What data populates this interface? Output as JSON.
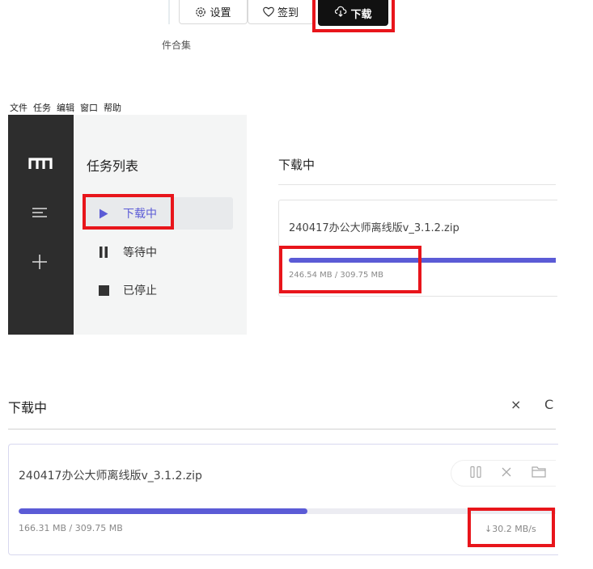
{
  "toolbar": {
    "settings_label": "设置",
    "checkin_label": "签到",
    "download_label": "下载",
    "collection_text": "件合集"
  },
  "menubar": [
    "文件",
    "任务",
    "编辑",
    "窗口",
    "帮助"
  ],
  "sidebar": {
    "title": "任务列表",
    "items": [
      {
        "label": "下载中",
        "icon": "play-icon",
        "active": true
      },
      {
        "label": "等待中",
        "icon": "pause-icon",
        "active": false
      },
      {
        "label": "已停止",
        "icon": "stop-icon",
        "active": false
      }
    ]
  },
  "mid_panel": {
    "title": "下载中",
    "filename": "240417办公大师离线版v_3.1.2.zip",
    "size_text": "246.54 MB / 309.75 MB",
    "progress": 0.796
  },
  "bottom_panel": {
    "title": "下载中",
    "close_icon": "×",
    "refresh_icon": "C",
    "filename": "240417办公大师离线版v_3.1.2.zip",
    "size_text": "166.31 MB / 309.75 MB",
    "speed_text": "↓30.2 MB/s",
    "progress": 0.537
  },
  "colors": {
    "accent": "#5b5bd6",
    "highlight": "#e8151b",
    "dark_sidebar": "#2d2d2d"
  }
}
